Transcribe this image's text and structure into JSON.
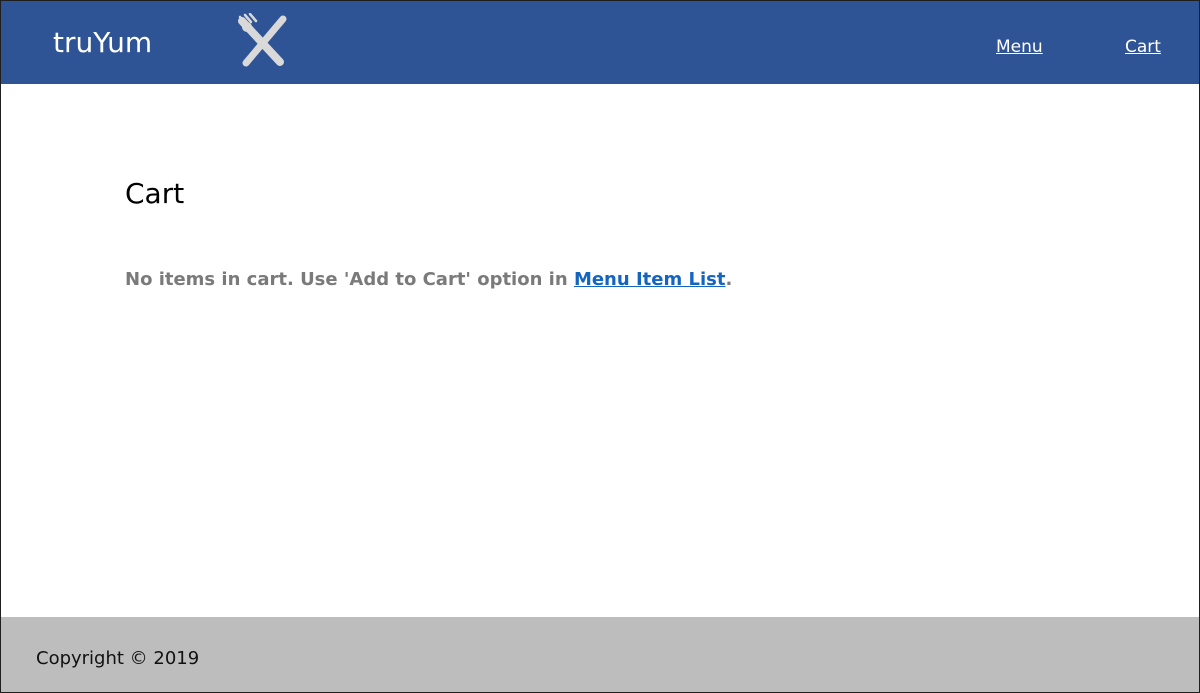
{
  "header": {
    "brand": "truYum",
    "logo_icon": "fork-knife-icon",
    "nav": {
      "menu_label": "Menu",
      "cart_label": "Cart"
    }
  },
  "main": {
    "title": "Cart",
    "message": {
      "prefix": "No items in cart. Use 'Add to Cart' option in ",
      "link_label": "Menu Item List",
      "suffix": "."
    }
  },
  "footer": {
    "copyright": "Copyright © 2019"
  },
  "colors": {
    "header_background": "#2f5496",
    "footer_background": "#bdbdbd",
    "link_color": "#1565c0",
    "message_text": "#7a7a7a"
  }
}
